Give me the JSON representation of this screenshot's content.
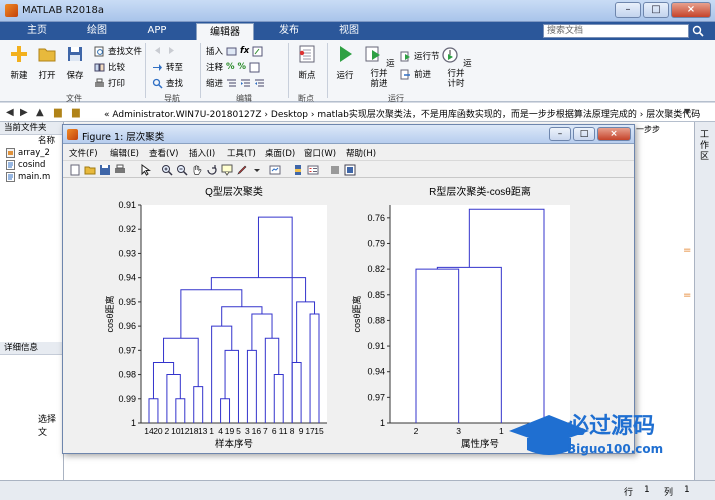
{
  "window": {
    "title": "MATLAB R2018a"
  },
  "tabs": [
    {
      "label": "主页"
    },
    {
      "label": "绘图"
    },
    {
      "label": "APP"
    },
    {
      "label": "编辑器"
    },
    {
      "label": "发布"
    },
    {
      "label": "视图"
    }
  ],
  "search": {
    "placeholder": "搜索文档"
  },
  "ribbon": {
    "new_label": "新建",
    "open_label": "打开",
    "save_label": "保存",
    "find_files_label": "查找文件",
    "compare_label": "比较",
    "print_label": "打印",
    "goto_label": "转至",
    "find_label": "查找",
    "insert_label": "插入",
    "comment_label": "注释",
    "indent_label": "缩进",
    "breakpoints_label": "断点",
    "run_label": "运行",
    "run_advance_label": "运行并\n前进",
    "run_section_label": "运行节",
    "advance_label": "前进",
    "run_time_label": "运行并\n计时",
    "groups": {
      "file": "文件",
      "nav": "导航",
      "edit": "编辑",
      "breakpoints": "断点",
      "run": "运行"
    }
  },
  "address": {
    "path": "« Administrator.WIN7U-20180127Z › Desktop › matlab实现层次聚类法，不是用库函数实现的，而是一步步根据算法原理完成的 › 层次聚类代码"
  },
  "left_panel": {
    "current_folder_label": "当前文件夹",
    "name_col": "名称",
    "files": [
      "array_2",
      "cosind",
      "main.m"
    ],
    "details_label": "详细信息",
    "select_label": "选择文"
  },
  "right_strip": {
    "label": "工作区"
  },
  "editor_hint": "一步步",
  "status": {
    "row_label": "行",
    "row_value": "1",
    "col_label": "列",
    "col_value": "1"
  },
  "figure": {
    "title": "Figure 1: 层次聚类",
    "menu": [
      "文件(F)",
      "编辑(E)",
      "查看(V)",
      "插入(I)",
      "工具(T)",
      "桌面(D)",
      "窗口(W)",
      "帮助(H)"
    ]
  },
  "chart_data": [
    {
      "type": "dendrogram",
      "title": "Q型层次聚类",
      "xlabel": "样本序号",
      "ylabel": "cosθ距离",
      "y_ticks": [
        "0.91",
        "0.92",
        "0.93",
        "0.94",
        "0.95",
        "0.96",
        "0.97",
        "0.98",
        "0.99",
        "1"
      ],
      "ylim": [
        0.91,
        1.0
      ],
      "y_reversed": true,
      "leaf_labels": [
        "14",
        "20",
        "2",
        "10",
        "12",
        "18",
        "13",
        "1",
        "4",
        "19",
        "5",
        "3",
        "16",
        "7",
        "6",
        "11",
        "8",
        "9",
        "17",
        "15"
      ],
      "merges": [
        {
          "left": 0,
          "right": 1,
          "height": 0.99
        },
        {
          "left": 3,
          "right": 4,
          "height": 0.99
        },
        {
          "left": 8,
          "right": 9,
          "height": 0.99
        },
        {
          "left": 2,
          "right": 3.5,
          "height": 0.98
        },
        {
          "left": 5,
          "right": 6,
          "height": 0.985
        },
        {
          "left": 8.5,
          "right": 10,
          "height": 0.97
        },
        {
          "left": 11,
          "right": 12,
          "height": 0.97
        },
        {
          "left": 14,
          "right": 15,
          "height": 0.98
        },
        {
          "left": 0.5,
          "right": 2.75,
          "height": 0.975
        },
        {
          "left": 13,
          "right": 14.5,
          "height": 0.965
        },
        {
          "left": 16,
          "right": 17,
          "height": 0.975
        },
        {
          "left": 18,
          "right": 19,
          "height": 0.955
        },
        {
          "left": 1.625,
          "right": 5.5,
          "height": 0.965
        },
        {
          "left": 7,
          "right": 9.25,
          "height": 0.96
        },
        {
          "left": 11.5,
          "right": 13.75,
          "height": 0.955
        },
        {
          "left": 16.5,
          "right": 18.5,
          "height": 0.95
        },
        {
          "left": 8.125,
          "right": 12.625,
          "height": 0.952
        },
        {
          "left": 3.5625,
          "right": 10.375,
          "height": 0.945
        },
        {
          "left": 6.96875,
          "right": 17.5,
          "height": 0.94
        },
        {
          "left": 12.234375,
          "right": 16.0,
          "height": 0.915
        }
      ]
    },
    {
      "type": "dendrogram",
      "title": "R型层次聚类-cosθ距离",
      "xlabel": "属性序号",
      "ylabel": "cosθ距离",
      "y_ticks": [
        "0.76",
        "0.79",
        "0.82",
        "0.85",
        "0.88",
        "0.91",
        "0.94",
        "0.97",
        "1"
      ],
      "ylim": [
        0.745,
        1.0
      ],
      "y_reversed": true,
      "leaf_labels": [
        "2",
        "3",
        "1",
        "4"
      ],
      "merges": [
        {
          "left": 0,
          "right": 1,
          "height": 0.82
        },
        {
          "left": 0.5,
          "right": 2,
          "height": 0.818
        },
        {
          "left": 1.25,
          "right": 3,
          "height": 0.75
        }
      ]
    }
  ],
  "watermark": {
    "brand": "必过源码",
    "url": "Biguo100.com"
  }
}
